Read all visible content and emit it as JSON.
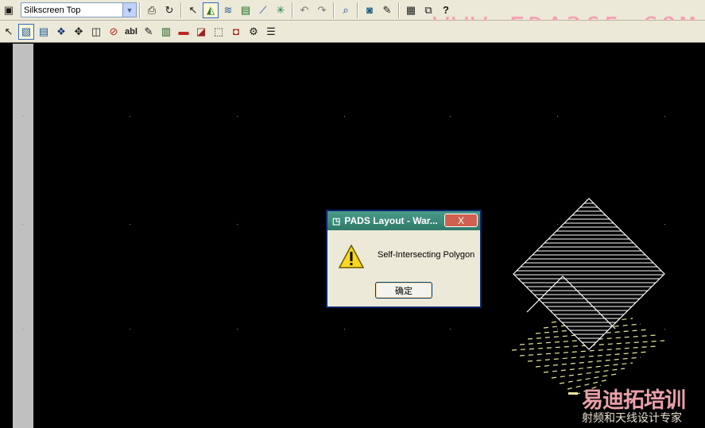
{
  "toolbar_top": {
    "layer_select": {
      "value": "Silkscreen Top"
    },
    "icons": [
      "save-icon",
      "properties-icon",
      "redraw-icon",
      "select-icon",
      "route-icon",
      "pour-icon",
      "board-outline-icon",
      "trace-icon",
      "sunburst-icon",
      "undo-icon",
      "redo-icon",
      "zoom-icon",
      "display-icon",
      "wizard-icon",
      "report-icon",
      "window-icon",
      "help-icon"
    ]
  },
  "toolbar_drafting": {
    "icons": [
      "select-mode-icon",
      "board-outline-icon",
      "copper-icon",
      "copper-cutout-icon",
      "plane-area-icon",
      "keepout-icon",
      "text-icon",
      "ab-text-icon",
      "dimension-icon",
      "library-icon",
      "sheet-icon",
      "drafting-icon",
      "part-icon",
      "report-icon",
      "list-icon"
    ],
    "text_label": "abl"
  },
  "watermark": {
    "text": "WWW.EDA365.COM"
  },
  "dialog": {
    "title": "PADS Layout - War...",
    "close_glyph": "X",
    "message": "Self-Intersecting Polygon",
    "ok_label": "确定"
  },
  "logo": {
    "main": "易迪拓培训",
    "sub": "射频和天线设计专家"
  },
  "colors": {
    "background": "#000000",
    "silk_outline": "#ffffff",
    "copper_hatch": "#e8e89a",
    "dialog_title": "#3a8a7a",
    "ruler": "#c0c0c0"
  }
}
